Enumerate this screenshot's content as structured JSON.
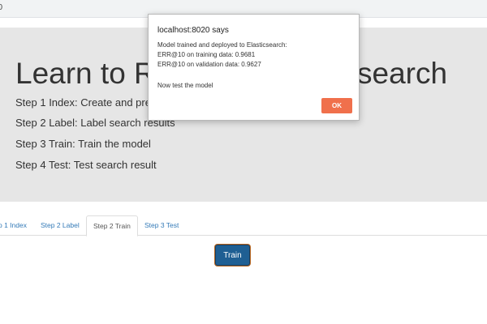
{
  "browser": {
    "address_fragment": "20"
  },
  "hero": {
    "title_left": "Learn to R",
    "title_right": "search",
    "steps": [
      "Step 1 Index: Create and prepa",
      "Step 2 Label: Label search results",
      "Step 3 Train: Train the model",
      "Step 4 Test: Test search result"
    ]
  },
  "tabs": [
    {
      "label": "p 1 Index",
      "active": false
    },
    {
      "label": "Step 2 Label",
      "active": false
    },
    {
      "label": "Step 2 Train",
      "active": true
    },
    {
      "label": "Step 3 Test",
      "active": false
    }
  ],
  "actions": {
    "train_label": "Train"
  },
  "dialog": {
    "title": "localhost:8020 says",
    "lines": [
      "Model trained and deployed to Elasticsearch:",
      "ERR@10 on training data: 0.9681",
      "ERR@10 on validation data: 0.9627",
      "Now test the model"
    ],
    "ok_label": "OK"
  },
  "colors": {
    "jumbotron_bg": "#e6e6e6",
    "tab_link": "#337ab7",
    "train_button": "#1f5f93",
    "ok_button": "#f0704c"
  }
}
